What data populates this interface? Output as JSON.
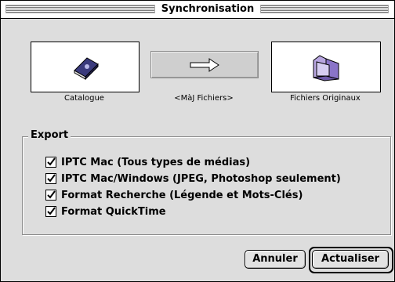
{
  "window": {
    "title": "Synchronisation"
  },
  "sources": {
    "catalogue_label": "Catalogue",
    "action_label": "<MàJ Fichiers>",
    "originals_label": "Fichiers Originaux"
  },
  "icons": {
    "catalogue": "book-icon",
    "action": "arrow-right-icon",
    "originals": "folder-icon"
  },
  "export": {
    "title": "Export",
    "options": [
      {
        "label": "IPTC Mac (Tous types de médias)",
        "checked": true
      },
      {
        "label": "IPTC Mac/Windows (JPEG, Photoshop seulement)",
        "checked": true
      },
      {
        "label": "Format Recherche (Légende et Mots-Clés)",
        "checked": true
      },
      {
        "label": "Format QuickTime",
        "checked": true
      }
    ]
  },
  "buttons": {
    "cancel": "Annuler",
    "ok": "Actualiser"
  }
}
